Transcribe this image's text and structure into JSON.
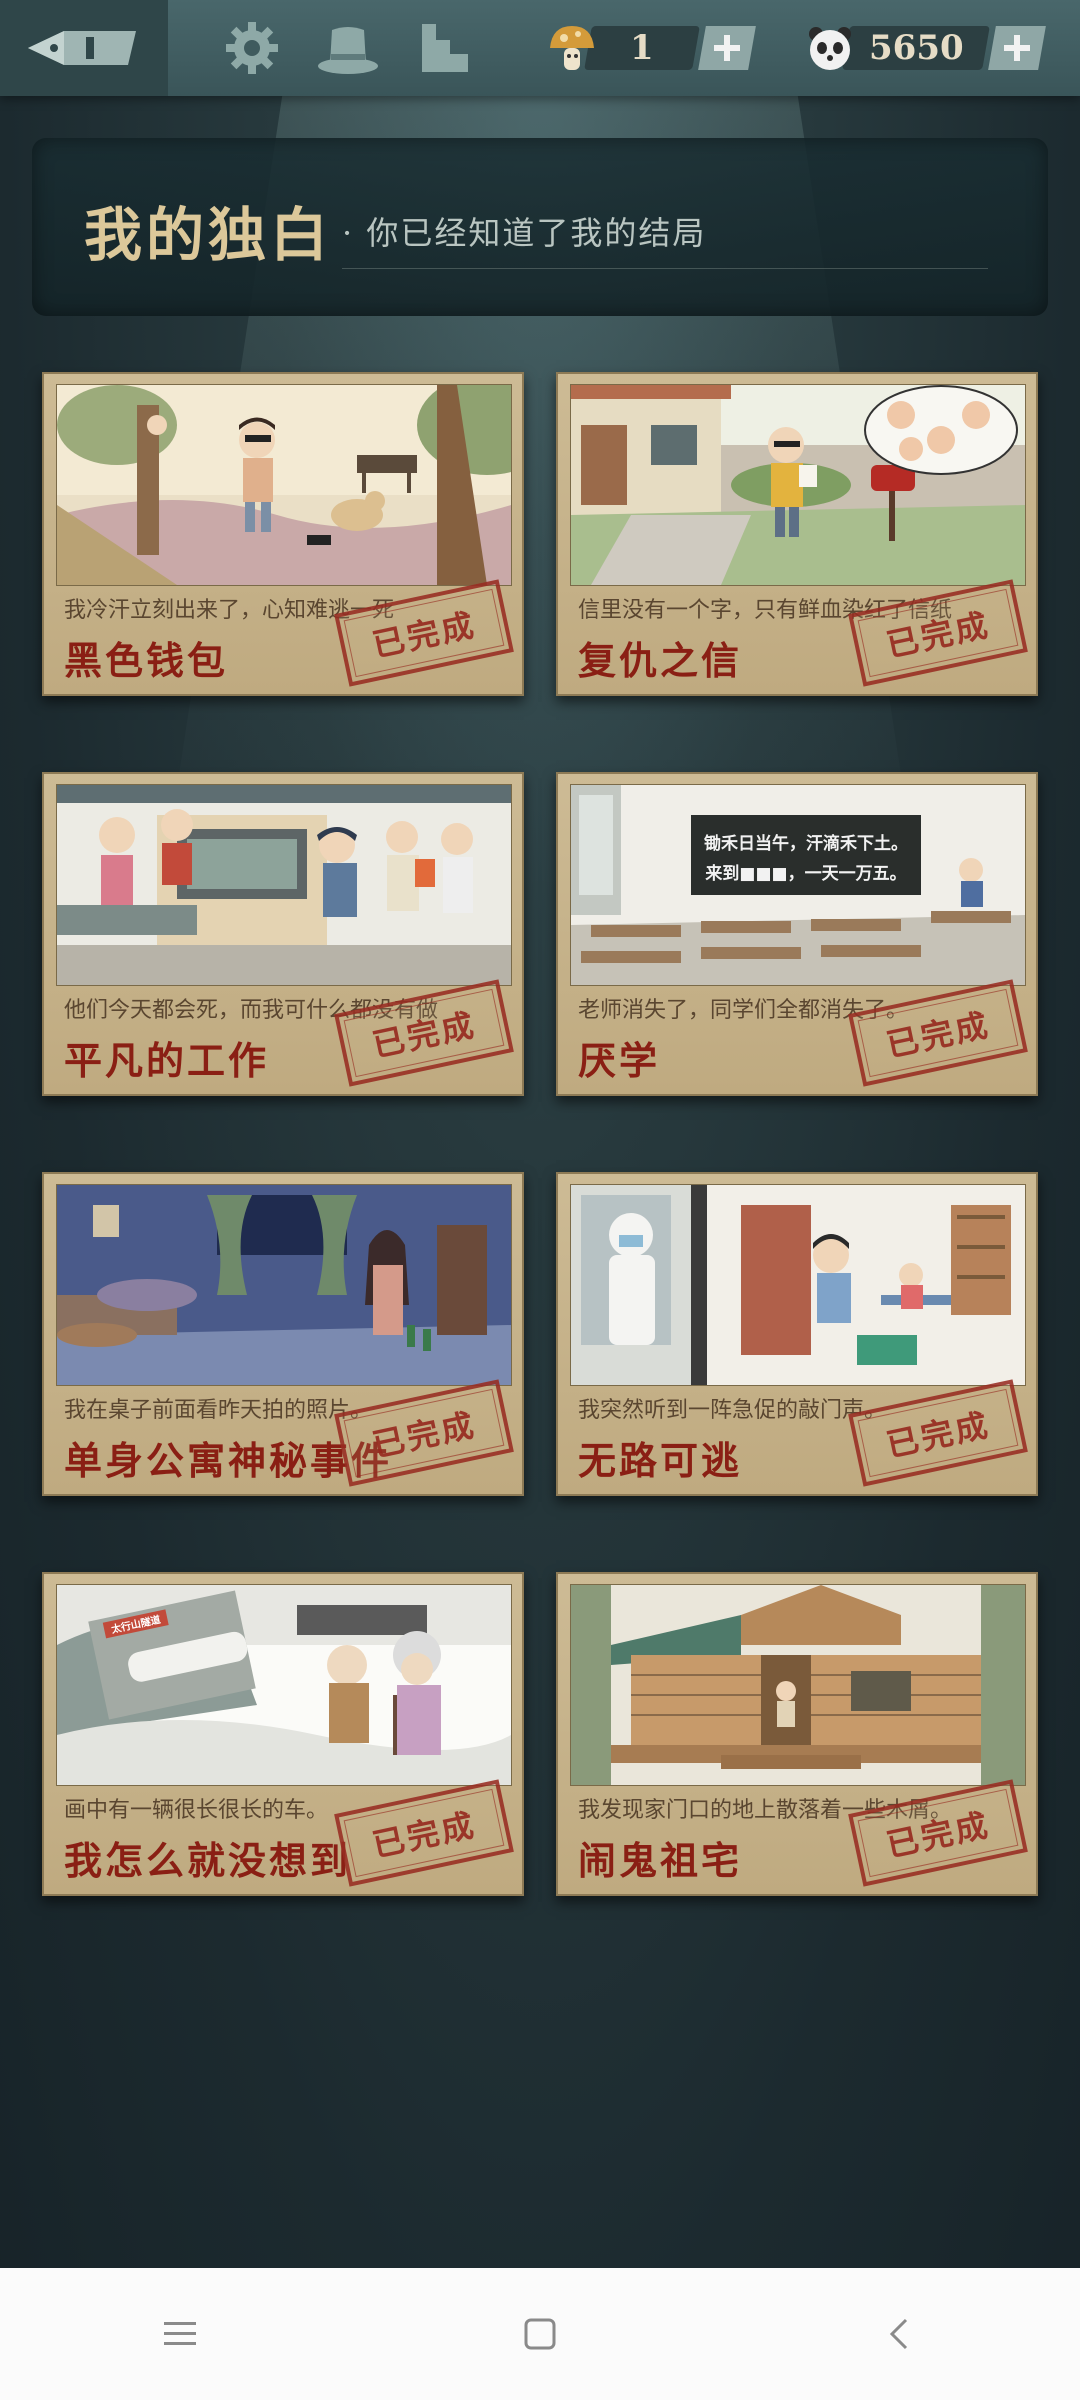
{
  "topbar": {
    "currencies": [
      {
        "name": "mushroom",
        "value": "1"
      },
      {
        "name": "panda",
        "value": "5650"
      }
    ]
  },
  "header": {
    "title": "我的独白",
    "subtitle": "· 你已经知道了我的结局"
  },
  "stories": [
    {
      "title": "黑色钱包",
      "desc": "我冷汗立刻出来了，心知难逃一死",
      "status": "已完成"
    },
    {
      "title": "复仇之信",
      "desc": "信里没有一个字，只有鲜血染红了信纸",
      "status": "已完成"
    },
    {
      "title": "平凡的工作",
      "desc": "他们今天都会死，而我可什么都没有做",
      "status": "已完成"
    },
    {
      "title": "厌学",
      "desc": "老师消失了，同学们全都消失了。",
      "status": "已完成"
    },
    {
      "title": "单身公寓神秘事件",
      "desc": "我在桌子前面看昨天拍的照片。",
      "status": "已完成"
    },
    {
      "title": "无路可逃",
      "desc": "我突然听到一阵急促的敲门声。",
      "status": "已完成"
    },
    {
      "title": "我怎么就没想到",
      "desc": "画中有一辆很长很长的车。",
      "status": "已完成"
    },
    {
      "title": "闹鬼祖宅",
      "desc": "我发现家门口的地上散落着一些木屑。",
      "status": "已完成"
    }
  ],
  "scenes": {
    "blackboard_line1": "锄禾日当午，汗滴禾下土。",
    "blackboard_line2": "来到■■■，一天一万五。",
    "tunnel_sign": "太行山隧道"
  },
  "colors": {
    "title_red": "#8a1f14",
    "stamp_red": "#962819",
    "paper": "#cdbb95",
    "bg": "#1c2a2f"
  }
}
